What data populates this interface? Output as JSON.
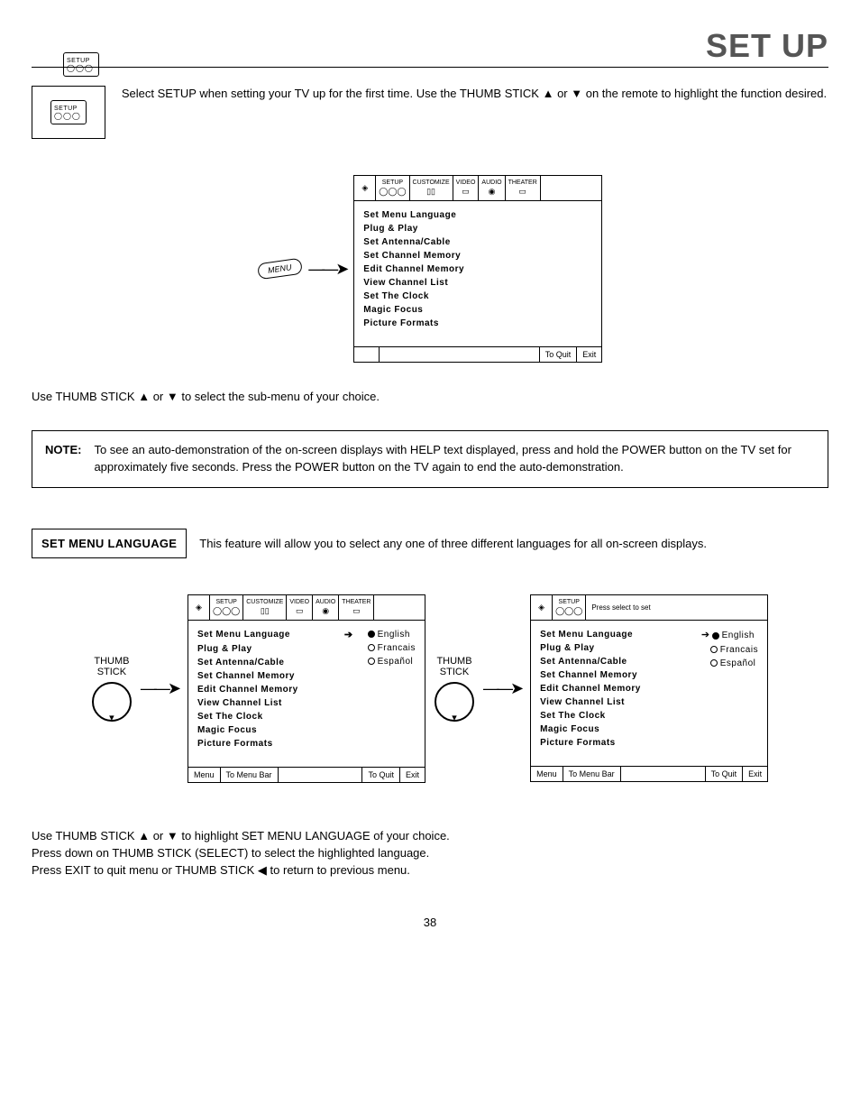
{
  "page": {
    "title": "SET UP",
    "number": "38"
  },
  "badge": {
    "label": "SETUP"
  },
  "intro": "Select SETUP when setting your TV up for the first time.  Use the THUMB STICK ▲ or ▼ on the remote to highlight the function desired.",
  "menu_button": "MENU",
  "osd_tabs": {
    "t1": "SETUP",
    "t2": "CUSTOMIZE",
    "t3": "VIDEO",
    "t4": "AUDIO",
    "t5": "THEATER"
  },
  "osd_items": {
    "i1": "Set Menu Language",
    "i2": "Plug & Play",
    "i3": "Set Antenna/Cable",
    "i4": "Set Channel Memory",
    "i5": "Edit Channel Memory",
    "i6": "View Channel List",
    "i7": "Set The Clock",
    "i8": "Magic Focus",
    "i9": "Picture Formats"
  },
  "osd_footer": {
    "menu": "Menu",
    "to_menu_bar": "To Menu Bar",
    "to_quit": "To Quit",
    "exit": "Exit"
  },
  "sub_instr": "Use THUMB STICK ▲ or ▼ to select the sub-menu of your choice.",
  "note": {
    "label": "NOTE:",
    "text": "To see an auto-demonstration of the on-screen displays with HELP text displayed, press and hold the POWER button on the TV set for approximately five seconds.  Press the POWER button on the TV again to end the auto-demonstration."
  },
  "section": {
    "label": "SET MENU LANGUAGE",
    "text": "This feature will allow you to select any one of three different languages for all on-screen displays."
  },
  "thumb": "THUMB\nSTICK",
  "hint": "Press select to set",
  "langs": {
    "l1": "English",
    "l2": "Francais",
    "l3": "Español"
  },
  "final": {
    "line1": "Use THUMB STICK ▲ or ▼ to highlight SET MENU LANGUAGE of your choice.",
    "line2": "Press down on THUMB STICK (SELECT) to select the highlighted language.",
    "line3": "Press EXIT to quit menu or THUMB STICK ◀ to return to previous menu."
  }
}
